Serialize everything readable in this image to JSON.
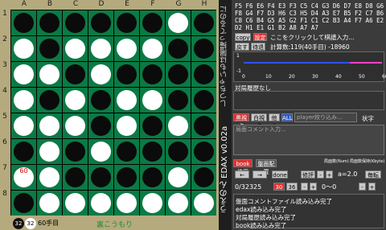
{
  "board": {
    "columns": [
      "A",
      "B",
      "C",
      "D",
      "E",
      "F",
      "G",
      "H"
    ],
    "rows": [
      "1",
      "2",
      "3",
      "4",
      "5",
      "6",
      "7",
      "8"
    ],
    "cells": [
      [
        "b",
        "b",
        "b",
        "b",
        "b",
        "b",
        "w",
        "b"
      ],
      [
        "w",
        "b",
        "w",
        "w",
        "w",
        "w",
        "b",
        "b"
      ],
      [
        "w",
        "w",
        "b",
        "w",
        "b",
        "b",
        "b",
        "b"
      ],
      [
        "w",
        "b",
        "w",
        "b",
        "w",
        "w",
        "b",
        "b"
      ],
      [
        "w",
        "w",
        "w",
        "b",
        "w",
        "b",
        "w",
        "b"
      ],
      [
        "b",
        "w",
        "b",
        "w",
        "b",
        "b",
        "b",
        "b"
      ],
      [
        "w",
        "w",
        "b",
        "b",
        "b",
        "b",
        "w",
        "b"
      ],
      [
        "b",
        "w",
        "w",
        "w",
        "w",
        "w",
        "w",
        "w"
      ]
    ],
    "last_move_label": "60"
  },
  "status": {
    "black_count": "32",
    "white_count": "32",
    "move_label": "60手目",
    "creator": "裏こうもり"
  },
  "strip": {
    "title": "うえのん EDAX v0.02a",
    "notice": "しつちゃいもは陽撮ってるのに"
  },
  "panel": {
    "moves": "F5 F6 E6 F4 E3 F3 C5 C4 G3 D6 D7 E8 D8 G6 F8 G4 F7 D3 H6 C3 H5 D4 A3 E7 B5 F2 C7 B6 C8 C6 B4 G5 A5 G2 F1 C1 C2 B3 A4 F7 A6 E2 D2 H1 E1 G1 B2 A8 A7 A7",
    "copy_label": "copy",
    "set_label": "設定",
    "click_hint": "ここをクリックして棋譜入力...",
    "retract_label": "戻す",
    "back_label": "待退",
    "calc_text": "計算数:119(40手目) -18960",
    "graph_ymax": "1",
    "graph_ymin": "-1",
    "graph_x": [
      "0",
      "10",
      "20",
      "30",
      "40",
      "50",
      "60"
    ],
    "history": "対局履歴なし",
    "mode_red": "黒視点",
    "btn_white": "白視点",
    "btn_other": "他人",
    "btn_all": "ALL",
    "player_placeholder": "player絞り込み...",
    "shape_label": "状字",
    "comment_placeholder": "局面コメント入力...",
    "book_label": "book使用",
    "reset_label": "盤面配置",
    "small1": "局面数(Num)",
    "small2": "局面数保持(Kbyte)",
    "prev_label": "←",
    "next_label": "→",
    "done_label": "done",
    "edit_label": "修評",
    "a_value": "a=2.0",
    "kaiten_label": "毎転",
    "pos_count": "0/32325",
    "level_red": "30",
    "level_num": "36",
    "range_label": "0〜0",
    "log": [
      "盤面コメントファイル読み込み完了",
      "edax読み込み完了",
      "対局履歴読み込み完了",
      "book読み込み完了"
    ]
  },
  "colors": {
    "board_green": "#0b7a45",
    "frame": "#b5aa7e",
    "eval_line": "#3050ff",
    "eval_future": "#ff40c0"
  }
}
